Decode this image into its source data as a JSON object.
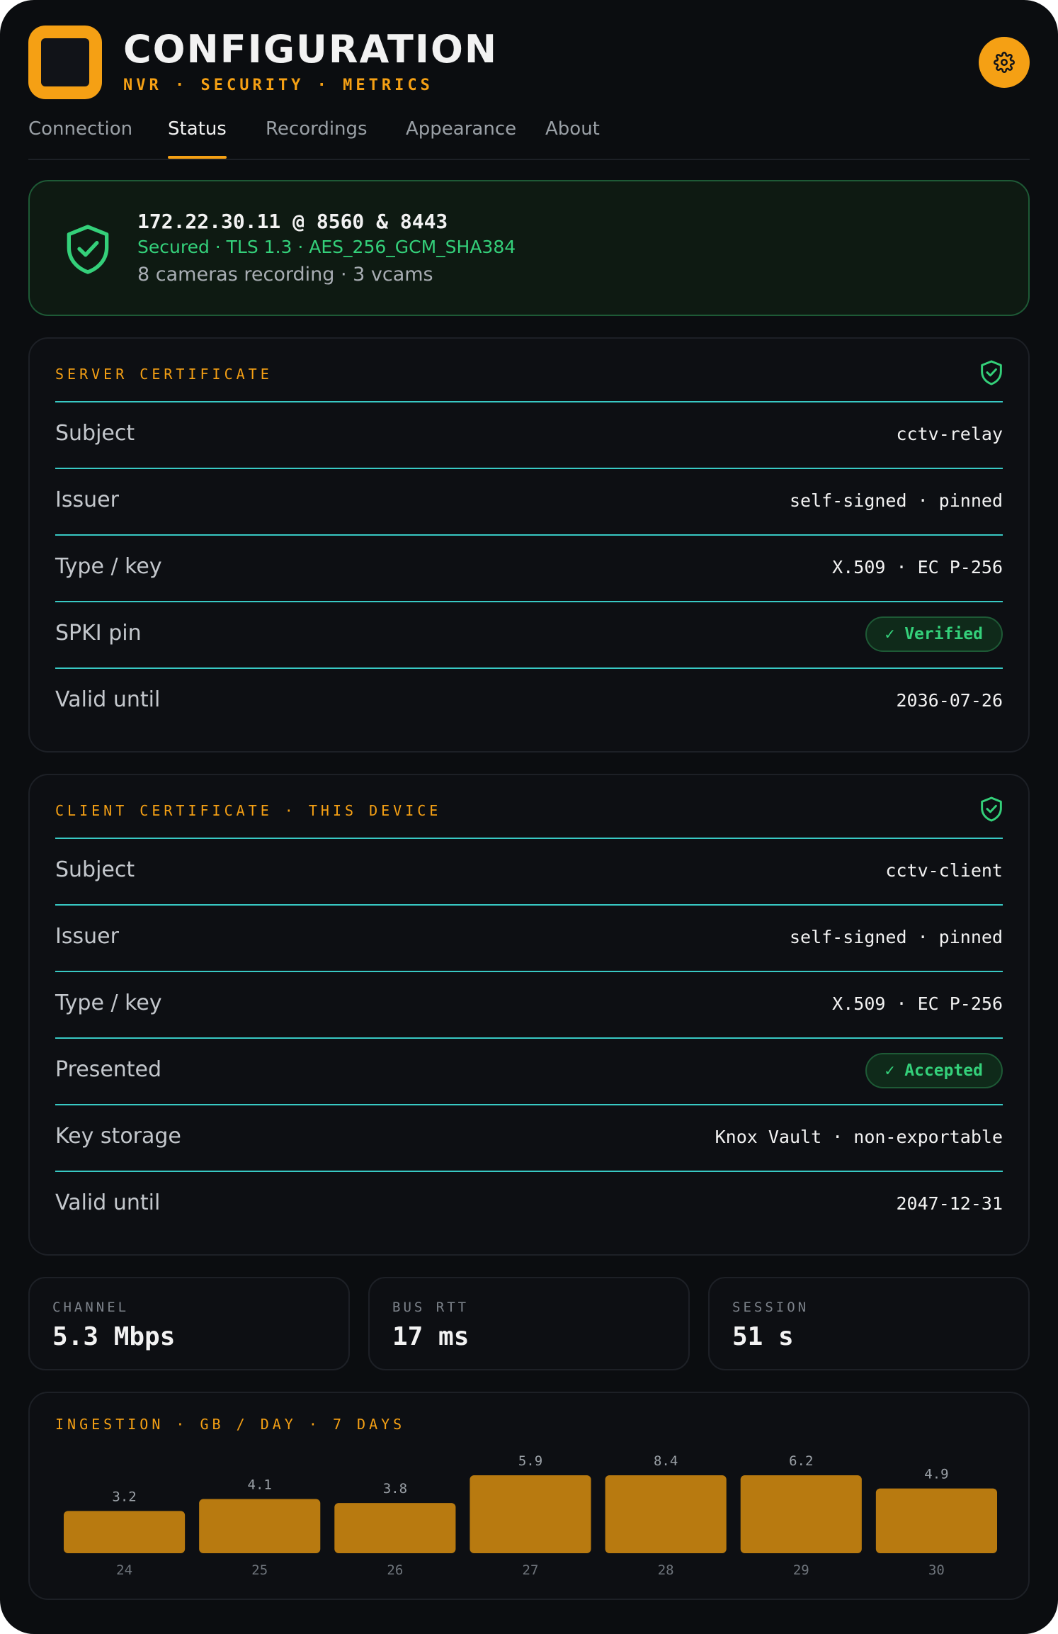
{
  "header": {
    "title": "CONFIGURATION",
    "subtitle": "NVR · SECURITY · METRICS",
    "logo_icon": "app-logo-icon",
    "settings_icon": "gear-icon",
    "accent": "#f5a014"
  },
  "tabs": [
    {
      "label": "Connection",
      "active": false
    },
    {
      "label": "Status",
      "active": true
    },
    {
      "label": "Recordings",
      "active": false
    },
    {
      "label": "Appearance",
      "active": false
    },
    {
      "label": "About",
      "active": false
    }
  ],
  "status": {
    "host": "172.22.30.11 @ 8560 & 8443",
    "tls": "Secured · TLS 1.3 · AES_256_GCM_SHA384",
    "cameras": "8 cameras recording · 3 vcams",
    "icon": "shield-check-icon",
    "color": "#34d07a"
  },
  "server_cert": {
    "heading": "SERVER CERTIFICATE",
    "rows": [
      {
        "label": "Subject",
        "value": "cctv-relay"
      },
      {
        "label": "Issuer",
        "value": "self-signed · pinned"
      },
      {
        "label": "Type / key",
        "value": "X.509 · EC P-256"
      },
      {
        "label": "SPKI pin",
        "value": "✓ Verified"
      },
      {
        "label": "Valid until",
        "value": "2036-07-26"
      }
    ]
  },
  "client_cert": {
    "heading": "CLIENT CERTIFICATE · THIS DEVICE",
    "rows": [
      {
        "label": "Subject",
        "value": "cctv-client"
      },
      {
        "label": "Issuer",
        "value": "self-signed · pinned"
      },
      {
        "label": "Type / key",
        "value": "X.509 · EC P-256"
      },
      {
        "label": "Presented",
        "value": "✓ Accepted"
      },
      {
        "label": "Key storage",
        "value": "Knox Vault · non-exportable"
      },
      {
        "label": "Valid until",
        "value": "2047-12-31"
      }
    ]
  },
  "metrics": [
    {
      "label": "CHANNEL",
      "value": "5.3 Mbps"
    },
    {
      "label": "BUS RTT",
      "value": "17 ms"
    },
    {
      "label": "SESSION",
      "value": "51 s"
    }
  ],
  "chart_data": {
    "type": "bar",
    "title": "INGESTION · GB / DAY · 7 DAYS",
    "categories": [
      "24",
      "25",
      "26",
      "27",
      "28",
      "29",
      "30"
    ],
    "values": [
      3.2,
      4.1,
      3.8,
      5.9,
      8.4,
      6.2,
      4.9
    ],
    "value_labels": [
      "3.2",
      "4.1",
      "3.8",
      "5.9",
      "8.4",
      "6.2",
      "4.9"
    ],
    "bar_color": "#b87a10",
    "ylim": [
      0,
      5.9
    ]
  }
}
